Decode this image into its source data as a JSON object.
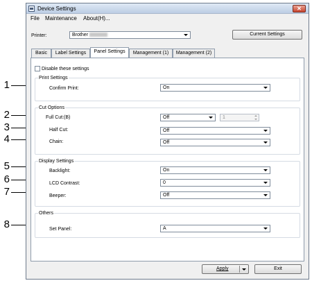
{
  "window": {
    "title": "Device Settings",
    "close_glyph": "✕"
  },
  "menu": [
    "File",
    "Maintenance",
    "About(H)..."
  ],
  "printer": {
    "label": "Printer:",
    "value": "Brother",
    "current_settings_button": "Current Settings"
  },
  "tabs": [
    {
      "label": "Basic",
      "active": false
    },
    {
      "label": "Label Settings",
      "active": false
    },
    {
      "label": "Panel Settings",
      "active": true
    },
    {
      "label": "Management (1)",
      "active": false
    },
    {
      "label": "Management (2)",
      "active": false
    }
  ],
  "disable_settings_label": "Disable these settings",
  "groups": {
    "print_settings": {
      "title": "Print Settings",
      "confirm_print": {
        "label": "Confirm Print:",
        "value": "On",
        "callout": "1"
      }
    },
    "cut_options": {
      "title": "Cut Options",
      "full_cut": {
        "label": "Full Cut:(B)",
        "value": "Off",
        "spinner_value": "1",
        "callout": "2"
      },
      "half_cut": {
        "label": "Half Cut:",
        "value": "Off",
        "callout": "3"
      },
      "chain": {
        "label": "Chain:",
        "value": "Off",
        "callout": "4"
      }
    },
    "display_settings": {
      "title": "Display Settings",
      "backlight": {
        "label": "Backlight:",
        "value": "On",
        "callout": "5"
      },
      "lcd_contrast": {
        "label": "LCD Contrast:",
        "value": "0",
        "callout": "6"
      },
      "beeper": {
        "label": "Beeper:",
        "value": "Off",
        "callout": "7"
      }
    },
    "others": {
      "title": "Others",
      "set_panel": {
        "label": "Set Panel:",
        "value": "A",
        "callout": "8"
      }
    }
  },
  "buttons": {
    "apply": "Apply",
    "exit": "Exit"
  },
  "colors": {
    "title_bar": "#bccde4",
    "close_button": "#c8442e",
    "window_bg": "#f0f0f0"
  }
}
